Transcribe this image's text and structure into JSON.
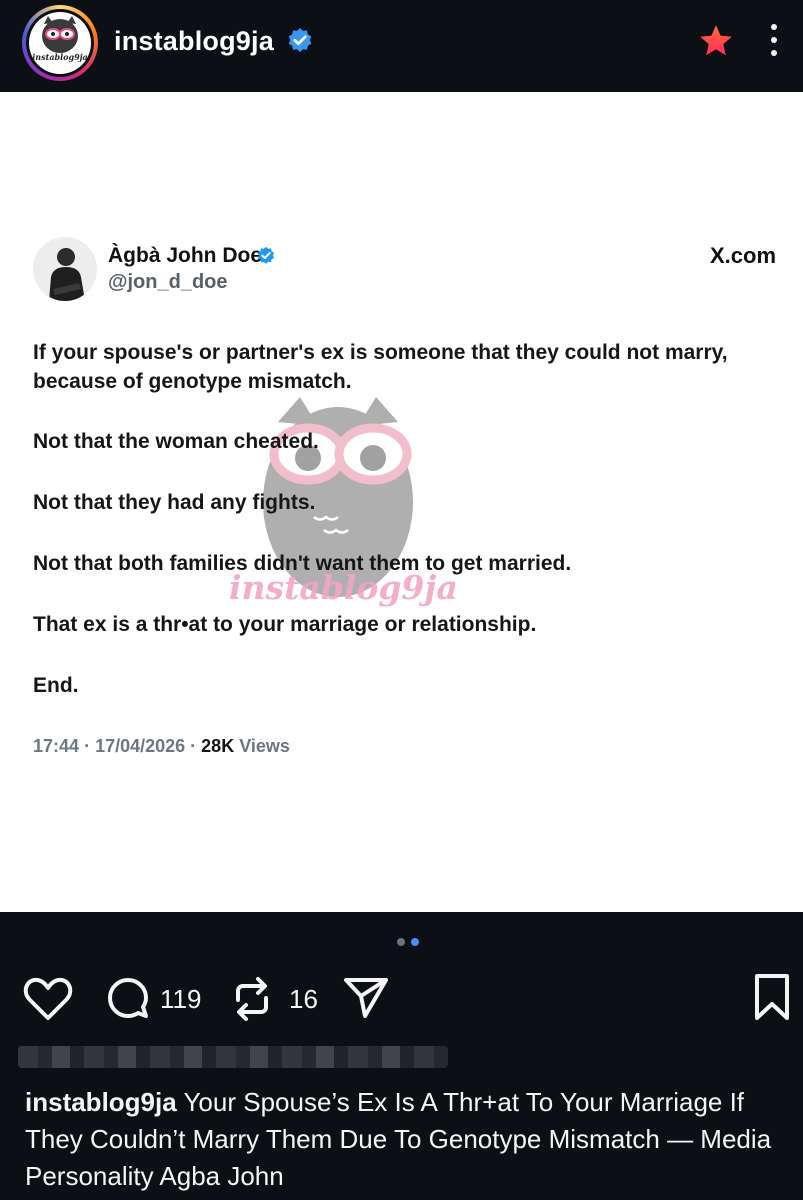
{
  "header": {
    "username": "instablog9ja",
    "avatar_logo_text": "instablog9ja",
    "icons": {
      "verified": "verified-badge-icon",
      "star": "star-icon",
      "more": "more-options-icon"
    },
    "colors": {
      "verified": "#3897f0",
      "star": "#ff4d2d"
    }
  },
  "tweet": {
    "author_name": "Àgbà John Doe",
    "handle": "@jon_d_doe",
    "source": "X.com",
    "paragraphs": [
      "If your spouse's or partner's ex is someone that they could not marry, because of genotype mismatch.",
      "Not that the woman cheated.",
      "Not that they had any fights.",
      "Not that both families didn't want them to get married.",
      "That ex is a thr•at to your marriage or relationship.",
      "End."
    ],
    "time": "17:44",
    "date": "17/04/2026",
    "views_count": "28K",
    "views_label": "Views",
    "watermark_text": "instablog9ja"
  },
  "carousel": {
    "total": 2,
    "active_index": 2
  },
  "actions": {
    "comments_count": "119",
    "reposts_count": "16",
    "icons": [
      "heart-icon",
      "comment-icon",
      "repost-icon",
      "share-icon",
      "bookmark-icon"
    ]
  },
  "caption": {
    "username": "instablog9ja",
    "text": "Your Spouse’s Ex Is A Thr+at To Your Marriage If They Couldn’t Marry Them Due To Genotype Mismatch — Media Personality Agba John"
  }
}
